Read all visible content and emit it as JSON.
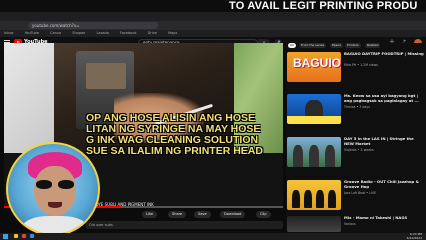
{
  "promo": {
    "text": "TO AVAIL LEGIT PRINTING PRODU"
  },
  "browser": {
    "address": "youtube.com/watch?v=",
    "bookmarks": [
      "Inbox",
      "YouTube",
      "Canva",
      "Shopee",
      "Lazada",
      "Facebook",
      "Drive",
      "Maps"
    ]
  },
  "youtube": {
    "wordmark": "YouTube",
    "search_value": "epty maintenance",
    "search_button": "⌕",
    "mic": "🎤"
  },
  "video": {
    "captions": [
      "OP ANG HOSE  ALISIN ANG HOSE",
      "LITAN NG SYRINGE NA MAY HOSE",
      "G INK WAG CLEANING SOLUTION",
      "SUE SA ILALIM NG PRINTER HEAD",
      ""
    ],
    "title_fragment": "FOR DYE SUBLI AND PIGMENT INK",
    "progress": 0.42,
    "actions": [
      "Like",
      "Share",
      "Save",
      "Download",
      "Clip"
    ],
    "description": "Ola user subs"
  },
  "chips": [
    "All",
    "From the series",
    "Epson",
    "Printers",
    "Related"
  ],
  "recommendations": [
    {
      "thumb_text": "BAGUIO",
      "title": "BAGUIO DAYTRIP FOODTRIP | Missing",
      "meta": "Mira PH • 1.2M views"
    },
    {
      "thumb_text": "",
      "title": "Ms. Keow sa usa ayl bagyong bgt | ang pagbagsak sa paglalagay at ...",
      "meta": "Thrizza • 3 days"
    },
    {
      "thumb_text": "",
      "title": "DAY 5 in the LAS IN | Stringe the NEW Market",
      "meta": "Viajeros • 2 weeks"
    },
    {
      "thumb_text": "",
      "title": "Groove Radio - OUT Chill Jazzhop & Groove Hop",
      "meta": "Jazz Lofi Beat • LIVE"
    },
    {
      "thumb_text": "",
      "title": "Mix - Mamo ni Takeshi | NAGS",
      "meta": "Various"
    }
  ],
  "clock": {
    "time": "6:24 PM",
    "date": "6/10/2024"
  },
  "colors": {
    "accent": "#ff0000",
    "caption": "#f2e07a",
    "facecam_ring": "#f5d43a"
  }
}
